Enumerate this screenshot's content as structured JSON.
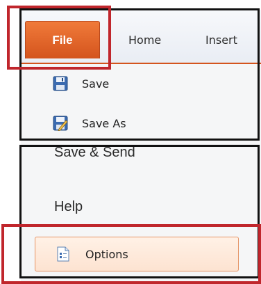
{
  "ribbon": {
    "tabs": [
      {
        "label": "File",
        "active": true
      },
      {
        "label": "Home",
        "active": false
      },
      {
        "label": "Insert",
        "active": false
      }
    ]
  },
  "backstage": {
    "commands": [
      {
        "label": "Save",
        "icon": "floppy-disk-icon"
      },
      {
        "label": "Save As",
        "icon": "save-as-icon"
      }
    ],
    "sections": [
      {
        "label": "Save & Send"
      },
      {
        "label": "Help"
      }
    ],
    "options": {
      "label": "Options",
      "icon": "options-document-icon",
      "highlighted": true
    }
  },
  "colors": {
    "file_tab": "#d4541d",
    "highlight_border": "#e59364",
    "annotation_red": "#c0262c",
    "annotation_black": "#111111"
  }
}
